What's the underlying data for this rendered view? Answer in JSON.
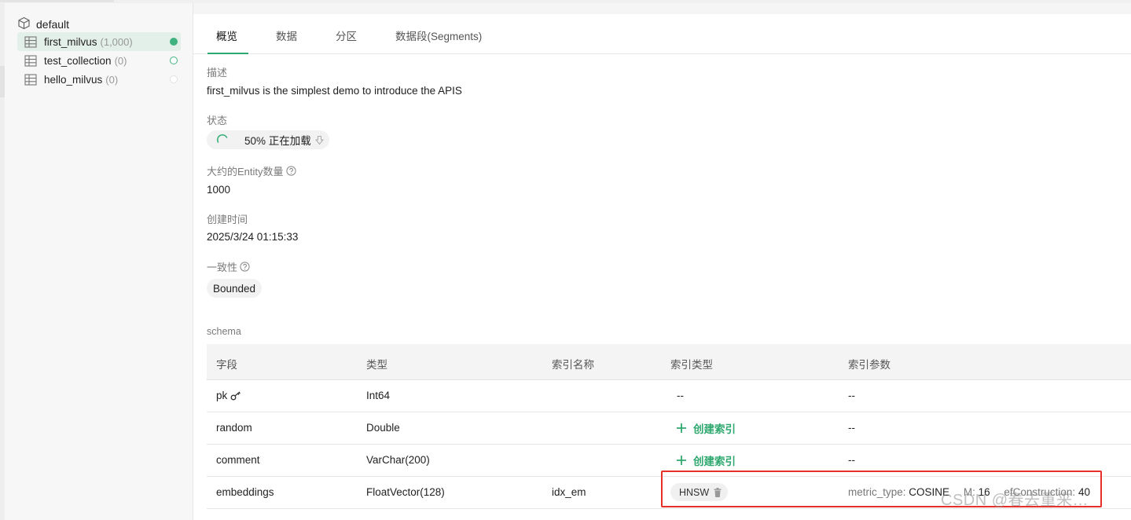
{
  "sidebar": {
    "database": {
      "name": "default",
      "icon": "database-cube-icon"
    },
    "collections": [
      {
        "name": "first_milvus",
        "count": "(1,000)",
        "status": "loaded",
        "status_color": "#3fb27f",
        "active": true
      },
      {
        "name": "test_collection",
        "count": "(0)",
        "status": "unloaded",
        "status_color": "#3fb27f",
        "active": false
      },
      {
        "name": "hello_milvus",
        "count": "(0)",
        "status": "empty",
        "status_color": "#dcdcdc",
        "active": false
      }
    ]
  },
  "tabs": [
    {
      "label": "概览",
      "active": true
    },
    {
      "label": "数据",
      "active": false
    },
    {
      "label": "分区",
      "active": false
    },
    {
      "label": "数据段(Segments)",
      "active": false
    }
  ],
  "overview": {
    "description_label": "描述",
    "description": "first_milvus is the simplest demo to introduce the APIS",
    "status_label": "状态",
    "status_text": "50% 正在加载",
    "load_progress": 0.5,
    "entity_label": "大约的Entity数量",
    "entity_count": "1000",
    "created_label": "创建时间",
    "created_time": "2025/3/24 01:15:33",
    "consistency_label": "一致性",
    "consistency": "Bounded"
  },
  "schema": {
    "label": "schema",
    "headers": [
      "字段",
      "类型",
      "索引名称",
      "索引类型",
      "索引参数"
    ],
    "rows": [
      {
        "field": "pk",
        "primary_key": true,
        "type": "Int64",
        "index_name": "",
        "index_type": "--",
        "index_params": "--"
      },
      {
        "field": "random",
        "type": "Double",
        "index_name": "",
        "create_index": "创建索引",
        "index_params": "--"
      },
      {
        "field": "comment",
        "type": "VarChar(200)",
        "index_name": "",
        "create_index": "创建索引",
        "index_params": "--"
      },
      {
        "field": "embeddings",
        "type": "FloatVector(128)",
        "index_name": "idx_em",
        "index_type": "HNSW",
        "params": [
          {
            "key": "metric_type:",
            "value": "COSINE"
          },
          {
            "key": "M:",
            "value": "16"
          },
          {
            "key": "efConstruction:",
            "value": "40"
          }
        ]
      }
    ]
  },
  "watermark": "CSDN @春去重来…",
  "colors": {
    "accent": "#2fa86f",
    "highlight_box": "#e8302b"
  }
}
